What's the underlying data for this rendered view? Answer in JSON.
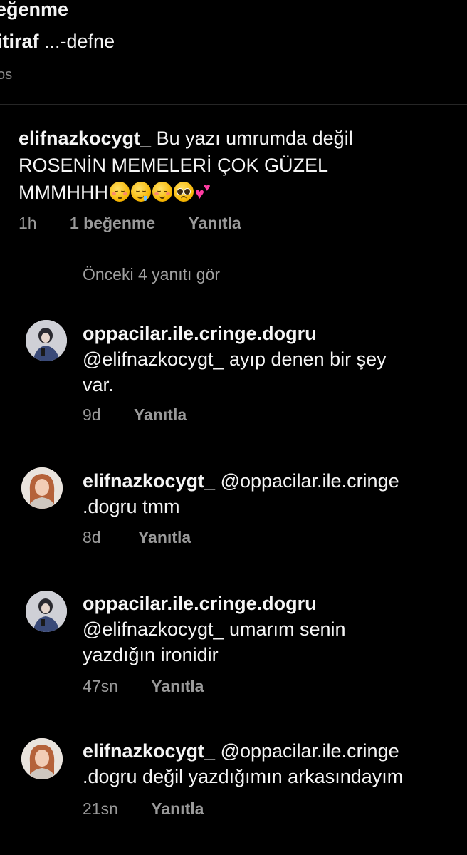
{
  "post": {
    "likes_text": "eğenme",
    "caption_user": "itiraf",
    "caption_text": " ...-defne",
    "meta_text": "os"
  },
  "comment": {
    "username": "elifnazkocygt_",
    "line1": " Bu yazı umrumda değil",
    "line2": "ROSENİN MEMELERİ ÇOK GÜZEL",
    "line3": "MMMHHH",
    "emojis": [
      "kissing-face-icon",
      "drooling-face-icon",
      "relieved-face-icon",
      "pleading-face-icon",
      "two-hearts-icon"
    ],
    "time": "1h",
    "likes": "1 beğenme",
    "reply_label": "Yanıtla"
  },
  "view_replies": "Önceki 4 yanıtı gör",
  "replies": [
    {
      "username": "oppacilar.ile.cringe.dogru",
      "text_line1": "@elifnazkocygt_ ayıp denen bir şey",
      "text_line2": "var.",
      "time": "9d",
      "reply_label": "Yanıtla"
    },
    {
      "username": "elifnazkocygt_",
      "text_line1_suffix": " @oppacilar.ile.cringe",
      "text_line2": ".dogru tmm",
      "time": "8d",
      "reply_label": "Yanıtla"
    },
    {
      "username": "oppacilar.ile.cringe.dogru",
      "text_line1": "@elifnazkocygt_ umarım senin",
      "text_line2": "yazdığın ironidir",
      "time": "47sn",
      "reply_label": "Yanıtla"
    },
    {
      "username": "elifnazkocygt_",
      "text_line1_suffix": " @oppacilar.ile.cringe",
      "text_line2": ".dogru değil yazdığımın arkasındayım",
      "time": "21sn",
      "reply_label": "Yanıtla"
    }
  ],
  "colors": {
    "background": "#000000",
    "text": "#f5f5f5",
    "meta": "#9a9a9a",
    "heart": "#ff3da2"
  }
}
